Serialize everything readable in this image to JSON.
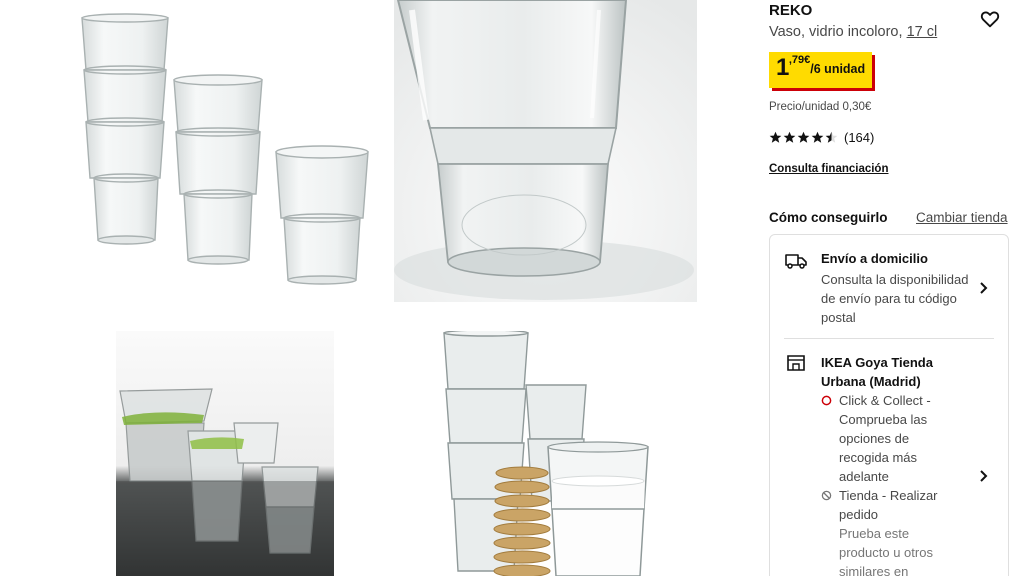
{
  "product": {
    "name": "REKO",
    "description": "Vaso, vidrio incoloro,",
    "size": "17 cl",
    "price": {
      "integer": "1",
      "decimal": ",79€",
      "unit": "/6 unidad"
    },
    "unit_price": "Precio/unidad 0,30€",
    "rating": {
      "value": 4.5,
      "max": 5,
      "count": "(164)"
    },
    "financing_link": "Consulta financiación"
  },
  "how_to_get": {
    "title": "Cómo conseguirlo",
    "change_store": "Cambiar tienda",
    "delivery": {
      "title": "Envío a domicilio",
      "text": "Consulta la disponibilidad de envío para tu código postal"
    },
    "store": {
      "name": "IKEA Goya Tienda Urbana (Madrid)",
      "click_collect": "Click & Collect - Comprueba las opciones de recogida más adelante",
      "in_store": "Tienda - Realizar pedido",
      "in_store_note": "Prueba este producto u otros similares en"
    }
  },
  "colors": {
    "price_badge": "#ffdb00",
    "price_shadow": "#cc0008",
    "click_collect_indicator": "#cc0008",
    "text_secondary": "#484848"
  },
  "icons": [
    "heart-icon",
    "star-icon",
    "truck-icon",
    "store-icon",
    "chevron-right-icon",
    "circle-icon",
    "prohibited-icon"
  ]
}
